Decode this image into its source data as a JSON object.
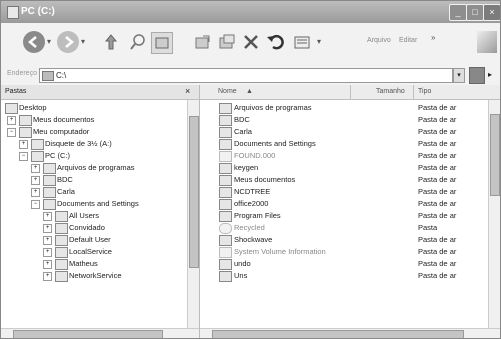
{
  "window": {
    "title": "PC (C:)"
  },
  "toolbar": {
    "rename_label": "Arquivo",
    "edit_label": "Editar"
  },
  "address": {
    "label": "Endereço",
    "value": "C:\\"
  },
  "folders_pane": {
    "title": "Pastas",
    "tree": [
      {
        "label": "Desktop"
      },
      {
        "label": "Meus documentos"
      },
      {
        "label": "Meu computador"
      },
      {
        "label": "Disquete de 3½ (A:)"
      },
      {
        "label": "PC (C:)"
      },
      {
        "label": "Arquivos de programas"
      },
      {
        "label": "BDC"
      },
      {
        "label": "Carla"
      },
      {
        "label": "Documents and Settings"
      },
      {
        "label": "All Users"
      },
      {
        "label": "Convidado"
      },
      {
        "label": "Default User"
      },
      {
        "label": "LocalService"
      },
      {
        "label": "Matheus"
      },
      {
        "label": "NetworkService"
      }
    ]
  },
  "list": {
    "columns": {
      "name": "Nome",
      "size": "Tamanho",
      "type": "Tipo"
    },
    "rows": [
      {
        "name": "Arquivos de programas",
        "type": "Pasta de ar"
      },
      {
        "name": "BDC",
        "type": "Pasta de ar"
      },
      {
        "name": "Carla",
        "type": "Pasta de ar"
      },
      {
        "name": "Documents and Settings",
        "type": "Pasta de ar"
      },
      {
        "name": "FOUND.000",
        "type": "Pasta de ar"
      },
      {
        "name": "keygen",
        "type": "Pasta de ar"
      },
      {
        "name": "Meus documentos",
        "type": "Pasta de ar"
      },
      {
        "name": "NCDTREE",
        "type": "Pasta de ar"
      },
      {
        "name": "office2000",
        "type": "Pasta de ar"
      },
      {
        "name": "Program Files",
        "type": "Pasta de ar"
      },
      {
        "name": "Recycled",
        "type": "Pasta"
      },
      {
        "name": "Shockwave",
        "type": "Pasta de ar"
      },
      {
        "name": "System Volume Information",
        "type": "Pasta de ar"
      },
      {
        "name": "undo",
        "type": "Pasta de ar"
      },
      {
        "name": "Uns",
        "type": "Pasta de ar"
      }
    ]
  }
}
